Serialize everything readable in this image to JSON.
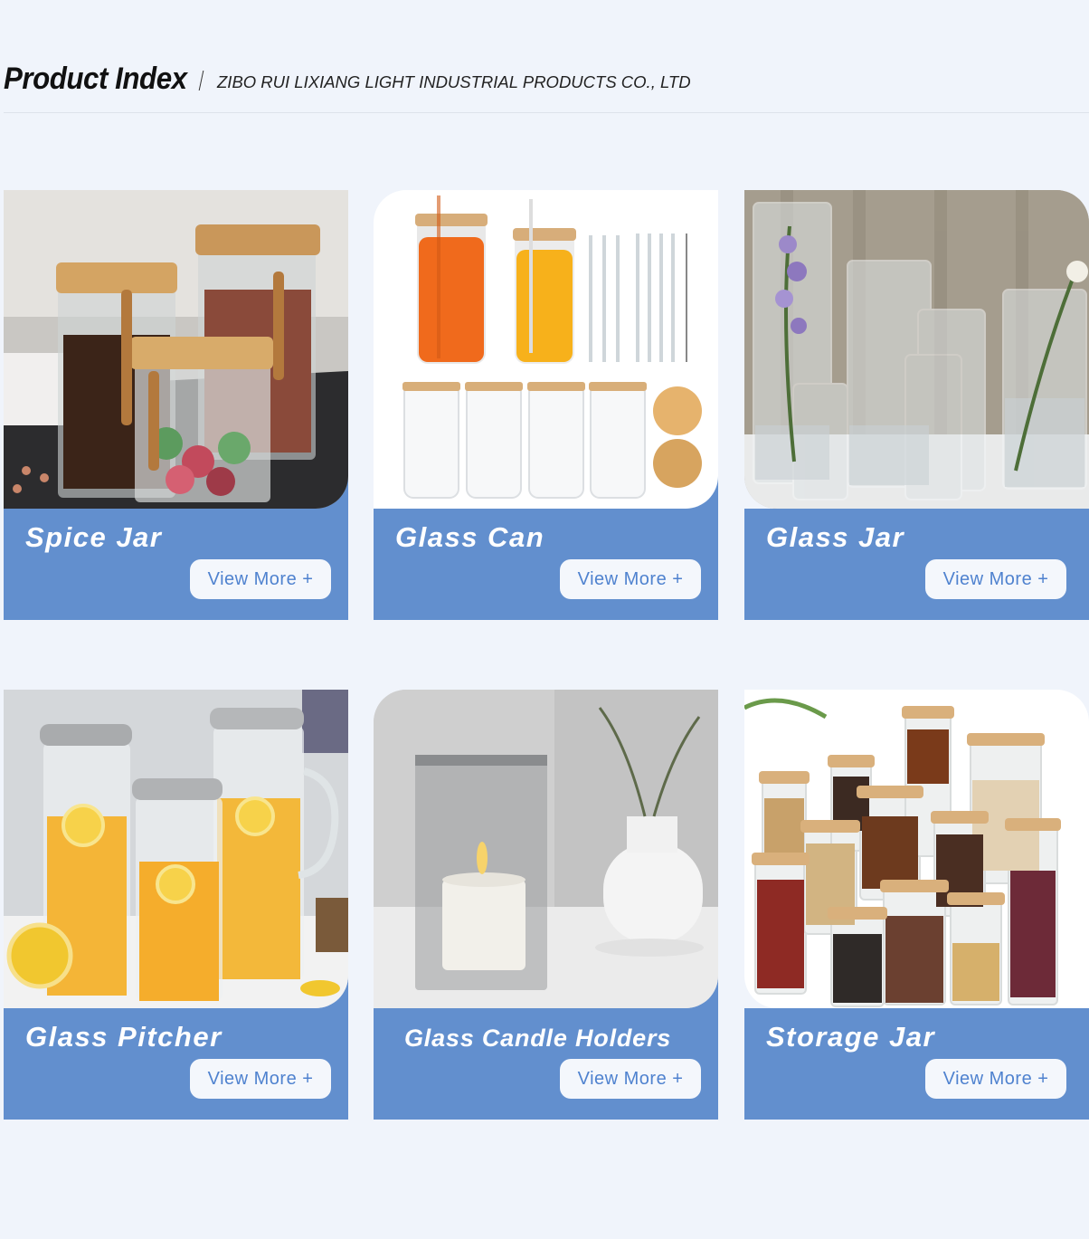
{
  "header": {
    "title": "Product Index",
    "company": "ZIBO RUI LIXIANG LIGHT INDUSTRIAL PRODUCTS CO., LTD"
  },
  "cards": [
    {
      "name": "Spice Jar",
      "button": "View More",
      "button_icon": "plus-icon",
      "button_symbol": "+"
    },
    {
      "name": "Glass Can",
      "button": "View More",
      "button_icon": "plus-icon",
      "button_symbol": "+"
    },
    {
      "name": "Glass Jar",
      "button": "View More",
      "button_icon": "plus-icon",
      "button_symbol": "+"
    },
    {
      "name": "Glass Pitcher",
      "button": "View More",
      "button_icon": "plus-icon",
      "button_symbol": "+"
    },
    {
      "name": "Glass Candle Holders",
      "button": "View More",
      "button_icon": "plus-icon",
      "button_symbol": "+"
    },
    {
      "name": "Storage Jar",
      "button": "View More",
      "button_icon": "plus-icon",
      "button_symbol": "+"
    }
  ],
  "colors": {
    "page_background": "#f0f4fb",
    "card_band": "#628fce",
    "button_background": "#f4f7fc",
    "button_text": "#4f82cf"
  }
}
